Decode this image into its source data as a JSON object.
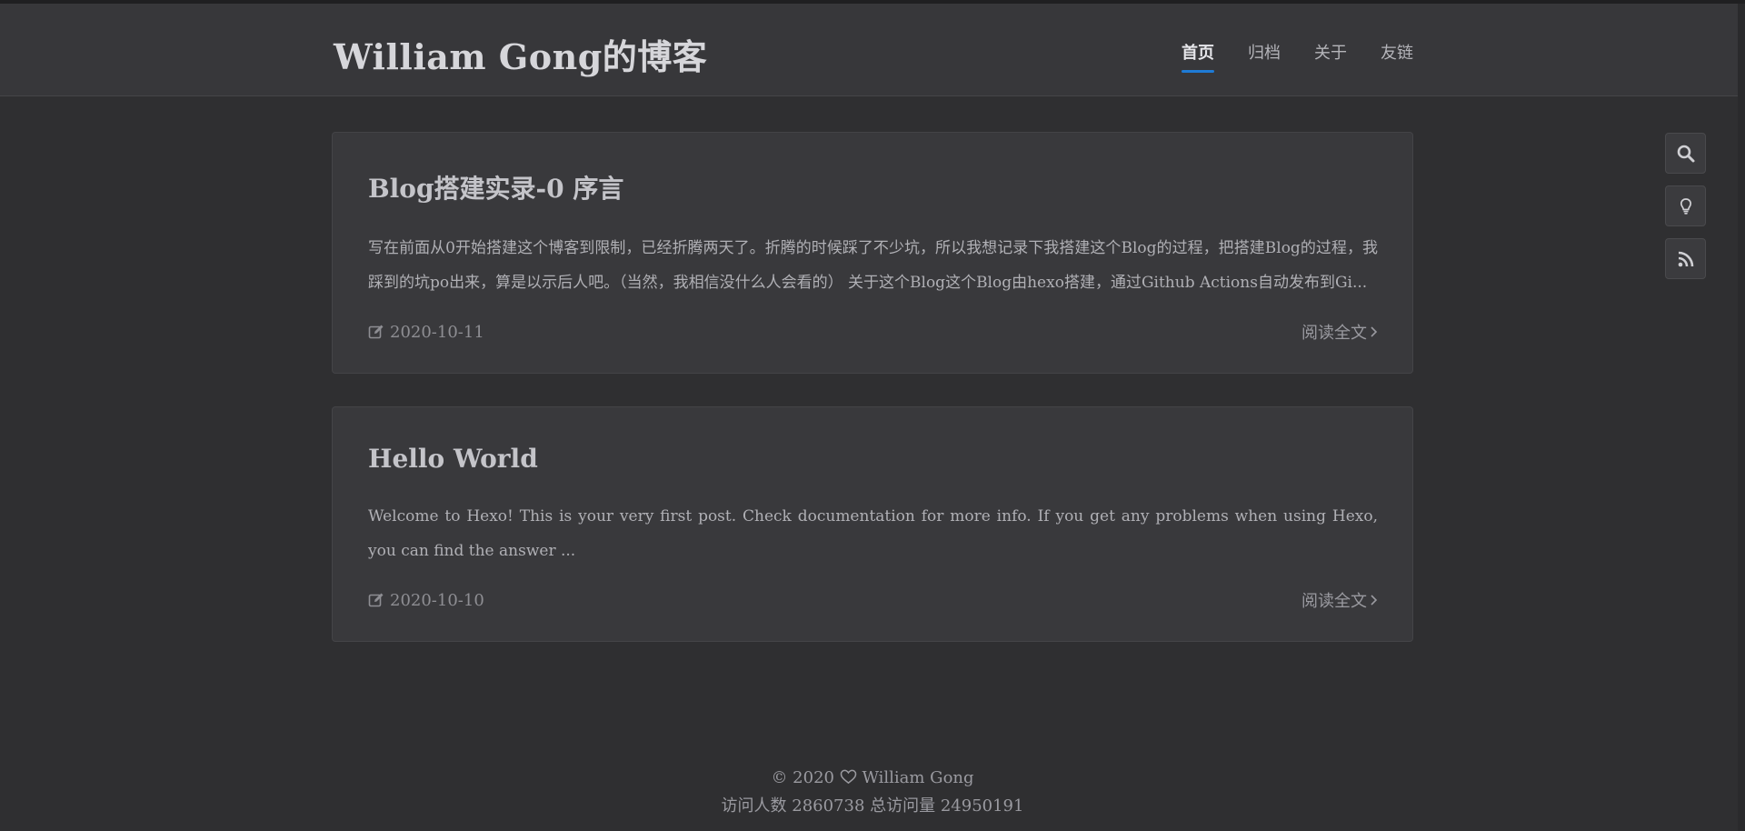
{
  "header": {
    "site_title": "William Gong的博客",
    "nav": [
      {
        "label": "首页",
        "active": true
      },
      {
        "label": "归档",
        "active": false
      },
      {
        "label": "关于",
        "active": false
      },
      {
        "label": "友链",
        "active": false
      }
    ]
  },
  "posts": [
    {
      "title": "Blog搭建实录-0 序言",
      "excerpt": "写在前面从0开始搭建这个博客到限制，已经折腾两天了。折腾的时候踩了不少坑，所以我想记录下我搭建这个Blog的过程，把搭建Blog的过程，我踩到的坑po出来，算是以示后人吧。（当然，我相信没什么人会看的） 关于这个Blog这个Blog由hexo搭建，通过Github Actions自动发布到Gi...",
      "date": "2020-10-11",
      "read_more": "阅读全文"
    },
    {
      "title": "Hello World",
      "excerpt": "Welcome to Hexo! This is your very first post. Check documentation for more info. If you get any problems when using Hexo, you can find the answer ...",
      "date": "2020-10-10",
      "read_more": "阅读全文"
    }
  ],
  "footer": {
    "copyright_prefix": "© 2020",
    "author": "William Gong",
    "stats": "访问人数 2860738 总访问量 24950191"
  },
  "side_tools": [
    "search-icon",
    "lightbulb-icon",
    "rss-icon"
  ],
  "colors": {
    "accent": "#1e7bd6",
    "background": "#2f2f31",
    "card": "#39393c"
  }
}
